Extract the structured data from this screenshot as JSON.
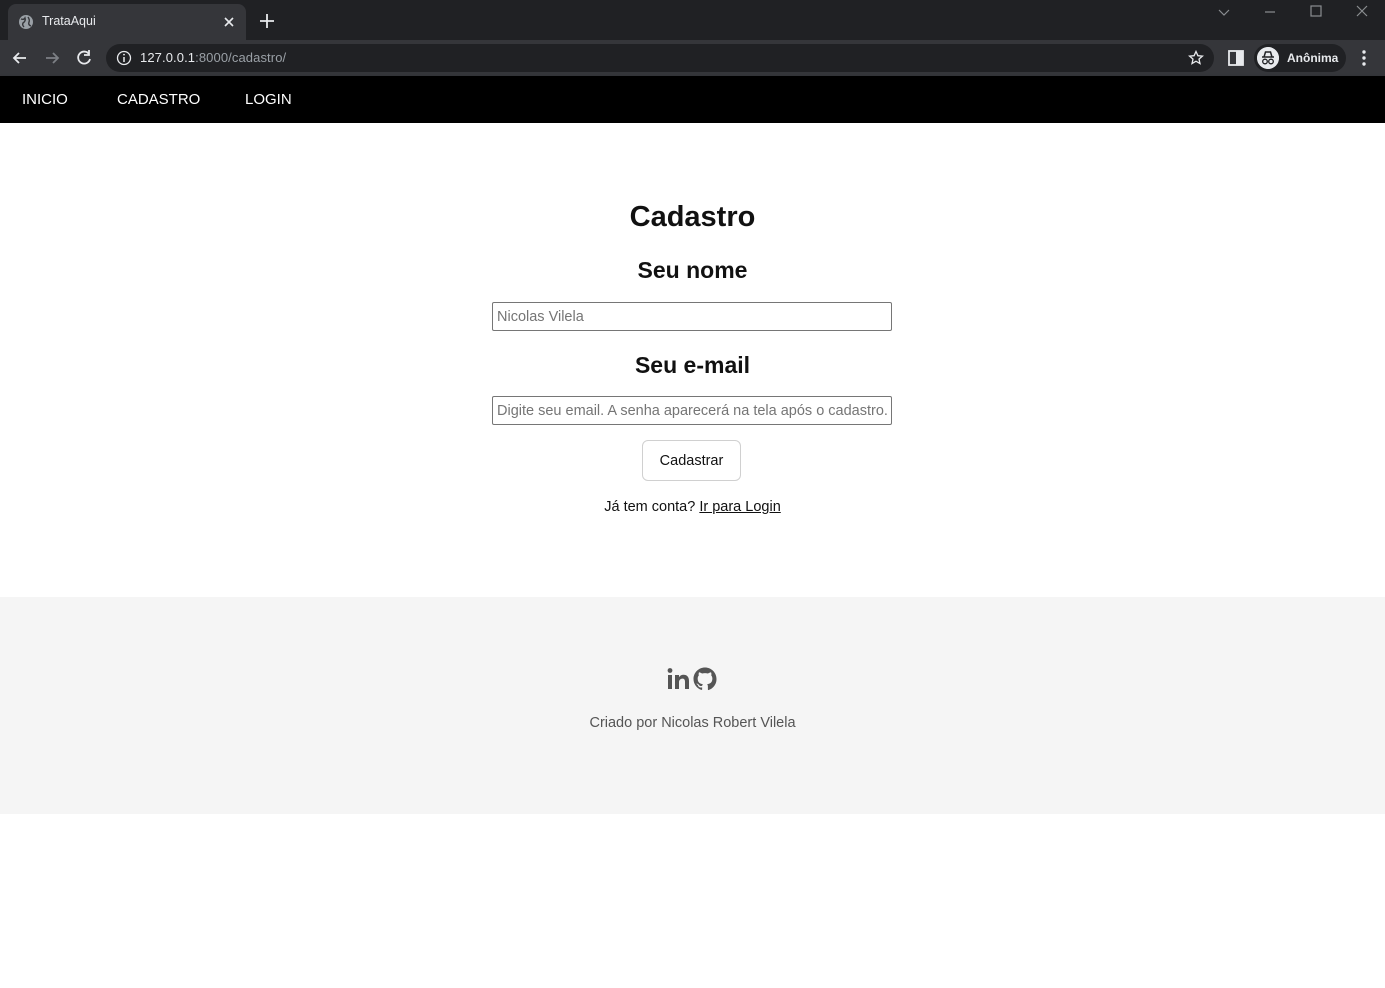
{
  "browser": {
    "tab_title": "TrataAqui",
    "url_host": "127.0.0.1",
    "url_rest": ":8000/cadastro/",
    "profile_label": "Anônima",
    "icons": [
      "globe-icon",
      "close-icon",
      "plus-icon",
      "back-arrow-icon",
      "forward-arrow-icon",
      "reload-icon",
      "info-icon",
      "star-icon",
      "side-panel-icon",
      "incognito-icon",
      "kebab-menu-icon"
    ]
  },
  "nav": {
    "items": [
      {
        "label": "INICIO"
      },
      {
        "label": "CADASTRO"
      },
      {
        "label": "LOGIN"
      }
    ]
  },
  "form": {
    "title": "Cadastro",
    "name_label": "Seu nome",
    "name_placeholder": "Nicolas Vilela",
    "email_label": "Seu e-mail",
    "email_placeholder": "Digite seu email. A senha aparecerá na tela após o cadastro.",
    "submit_label": "Cadastrar",
    "login_prompt": "Já tem conta?",
    "login_link": "Ir para Login"
  },
  "footer": {
    "social": [
      "linkedin-icon",
      "github-icon"
    ],
    "credit": "Criado por Nicolas Robert Vilela"
  },
  "colors": {
    "nav_bg": "#000000",
    "footer_bg": "#f5f5f5",
    "chrome_dark": "#202124",
    "chrome_toolbar": "#35363a"
  }
}
